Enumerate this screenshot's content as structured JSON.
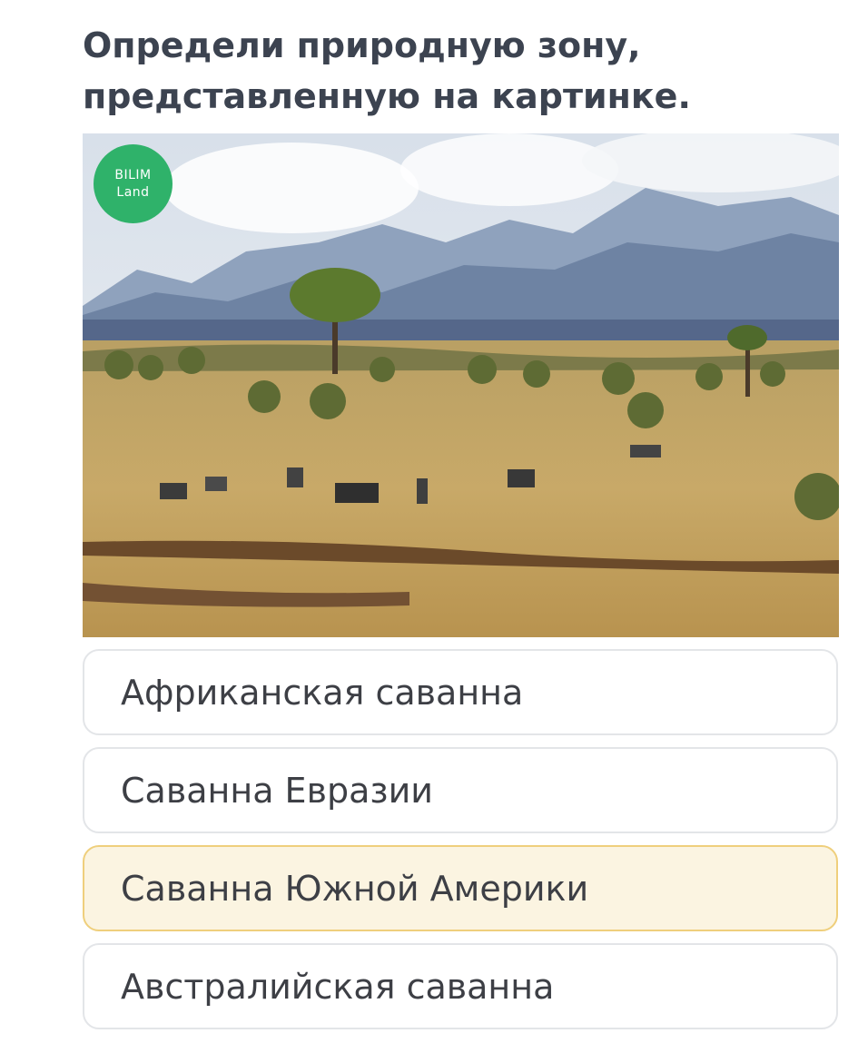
{
  "question": {
    "line1": "Определи природную зону,",
    "line2": "представленную на картинке."
  },
  "image": {
    "logo_line1": "BILIM",
    "logo_line2": "Land",
    "logo_color": "#2fb26a"
  },
  "options": [
    {
      "label": "Африканская саванна",
      "selected": false
    },
    {
      "label": "Саванна Евразии",
      "selected": false
    },
    {
      "label": "Саванна Южной Америки",
      "selected": true
    },
    {
      "label": "Австралийская саванна",
      "selected": false
    }
  ],
  "colors": {
    "selected_background": "#fbf4e1",
    "selected_border": "#efcf7c",
    "option_border": "#e3e5e8",
    "question_text": "#3c4350"
  }
}
